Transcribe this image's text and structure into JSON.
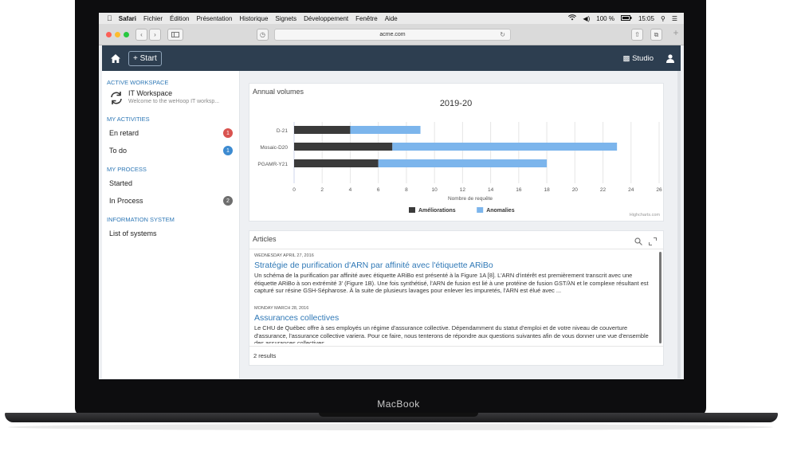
{
  "menubar": {
    "app": "Safari",
    "items": [
      "Fichier",
      "Édition",
      "Présentation",
      "Historique",
      "Signets",
      "Développement",
      "Fenêtre",
      "Aide"
    ],
    "battery": "100 %",
    "time": "15:05"
  },
  "browser": {
    "url": "acme.com"
  },
  "header": {
    "start_label": "+ Start",
    "studio_label": "Studio"
  },
  "sidebar": {
    "workspace_section": "ACTIVE WORKSPACE",
    "workspace_title": "IT Workspace",
    "workspace_subtitle": "Welcome to the weHoop IT worksp...",
    "activities_section": "MY ACTIVITIES",
    "activities": [
      {
        "label": "En retard",
        "badge": "1"
      },
      {
        "label": "To do",
        "badge": "1"
      }
    ],
    "process_section": "MY PROCESS",
    "process": [
      {
        "label": "Started",
        "badge": ""
      },
      {
        "label": "In Process",
        "badge": "2"
      }
    ],
    "info_section": "INFORMATION SYSTEM",
    "info": [
      {
        "label": "List of systems"
      }
    ]
  },
  "chart_card": {
    "title": "Annual volumes",
    "credit": "Highcharts.com"
  },
  "chart_data": {
    "type": "bar",
    "stacked": true,
    "orientation": "horizontal",
    "title": "2019-20",
    "categories": [
      "D-21",
      "Mosaic-D20",
      "PGAMR-Y21"
    ],
    "series": [
      {
        "name": "Améliorations",
        "color": "#3a3a3a",
        "values": [
          4,
          7,
          6
        ]
      },
      {
        "name": "Anomalies",
        "color": "#7cb5ec",
        "values": [
          5,
          16,
          12
        ]
      }
    ],
    "xlabel": "Nombre de requête",
    "xticks": [
      0,
      2,
      4,
      6,
      8,
      10,
      12,
      14,
      16,
      18,
      20,
      22,
      24,
      26
    ],
    "xlim": [
      0,
      26
    ],
    "legend_position": "bottom"
  },
  "articles": {
    "title": "Articles",
    "results": "2 results",
    "items": [
      {
        "date": "WEDNESDAY APRIL 27, 2016",
        "title": "Stratégie de purification d'ARN par affinité avec l'étiquette ARiBo",
        "body": "Un schéma de la purification par affinité avec étiquette ARiBo est présenté à la Figure 1A [8]. L'ARN d'intérêt est premièrement transcrit avec une étiquette ARiBo à son extrémité 3' (Figure 1B). Une fois synthétisé, l'ARN de fusion est lié à une protéine de fusion GST/λN et le complexe résultant est capturé sur résine GSH-Sépharose. À la suite de plusieurs lavages pour enlever les impuretés, l'ARN est élué avec ..."
      },
      {
        "date": "MONDAY MARCH 28, 2016",
        "title": "Assurances collectives",
        "body": "Le CHU de Québec offre à ses employés un régime d'assurance collective. Dépendamment du statut d'emploi et de votre niveau de couverture d'assurance, l'assurance collective variera. Pour ce faire, nous tenterons de répondre aux questions suivantes afin de vous donner une vue d'ensemble des assurances collectives."
      }
    ]
  },
  "device": {
    "label": "MacBook"
  }
}
